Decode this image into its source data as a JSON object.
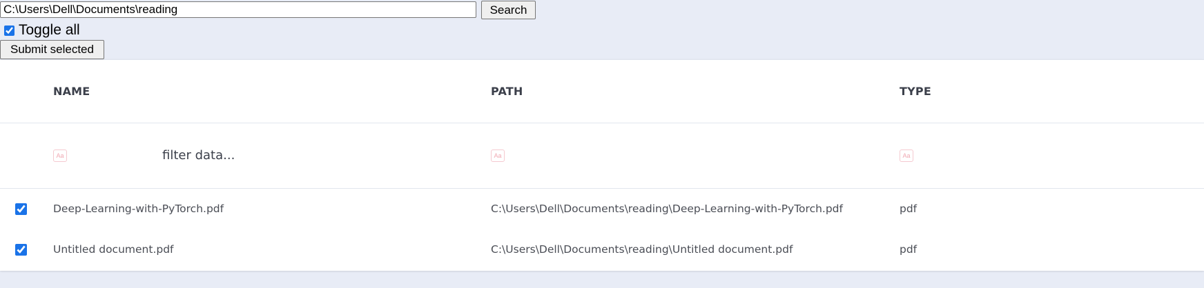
{
  "toolbar": {
    "search_value": "C:\\Users\\Dell\\Documents\\reading",
    "search_label": "Search",
    "toggle_all_label": "Toggle all",
    "toggle_all_checked": true,
    "submit_label": "Submit selected"
  },
  "table": {
    "columns": [
      "NAME",
      "PATH",
      "TYPE"
    ],
    "filter_placeholder": "filter data...",
    "filter_icon_text": "Aa",
    "rows": [
      {
        "checked": true,
        "name": "Deep-Learning-with-PyTorch.pdf",
        "path": "C:\\Users\\Dell\\Documents\\reading\\Deep-Learning-with-PyTorch.pdf",
        "type": "pdf"
      },
      {
        "checked": true,
        "name": "Untitled document.pdf",
        "path": "C:\\Users\\Dell\\Documents\\reading\\Untitled document.pdf",
        "type": "pdf"
      }
    ]
  },
  "colors": {
    "page_background": "#e8ecf6",
    "table_background": "#ffffff",
    "checkbox_accent": "#1a73e8",
    "filter_icon": "#f0a8b2"
  },
  "icons": [
    "case-sensitive-icon"
  ]
}
